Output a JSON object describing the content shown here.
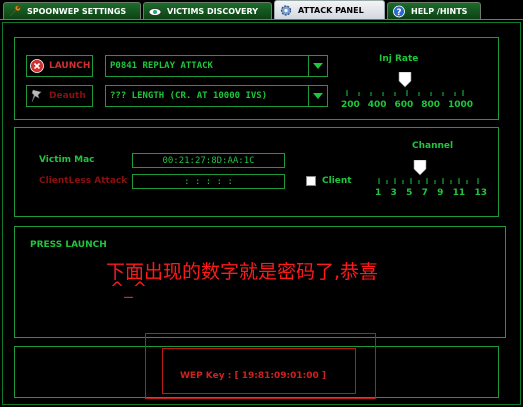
{
  "tabs": [
    {
      "label": "SPOONWEP SETTINGS",
      "active": false
    },
    {
      "label": "VICTIMS DISCOVERY",
      "active": false
    },
    {
      "label": "ATTACK PANEL",
      "active": true
    },
    {
      "label": "HELP /HINTS",
      "active": false
    }
  ],
  "launch": {
    "label": "LAUNCH",
    "attack": "P0841 REPLAY ATTACK"
  },
  "deauth": {
    "label": "Deauth",
    "length": "??? LENGTH (CR. AT 10000 IVS)"
  },
  "inj_rate": {
    "label": "Inj Rate",
    "ticks": [
      "200",
      "400",
      "600",
      "800",
      "1000"
    ],
    "value": "600"
  },
  "victim": {
    "mac_label": "Victim Mac",
    "mac_value": "00:21:27:8D:AA:1C",
    "client_label": "ClientLess Attack",
    "client_value": ": : : : :",
    "client_checkbox_label": "Client"
  },
  "channel": {
    "label": "Channel",
    "ticks": [
      "1",
      "3",
      "5",
      "7",
      "9",
      "11",
      "13"
    ],
    "value": "7"
  },
  "status": {
    "press": "PRESS LAUNCH",
    "overlay": "下面出现的数字就是密码了,恭喜",
    "overlay2": "^_^"
  },
  "wep": {
    "text": "WEP Key : [ 19:81:09:01:00 ]"
  },
  "colors": {
    "green": "#1ec63c",
    "border": "#1e9a3a",
    "red": "#ff1a1a"
  }
}
